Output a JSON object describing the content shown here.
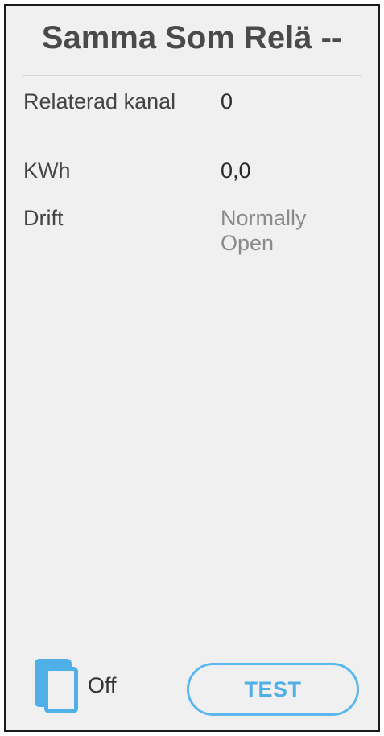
{
  "header": {
    "title": "Samma Som Relä --"
  },
  "fields": [
    {
      "label": "Relaterad kanal",
      "value": "0"
    },
    {
      "label": "KWh",
      "value": "0,0"
    },
    {
      "label": "Drift",
      "value": "Normally Open"
    }
  ],
  "footer": {
    "status_icon": "copy-icon",
    "status_text": "Off",
    "test_label": "TEST"
  },
  "colors": {
    "accent": "#4fb0e8",
    "background": "#f0f0f0"
  }
}
